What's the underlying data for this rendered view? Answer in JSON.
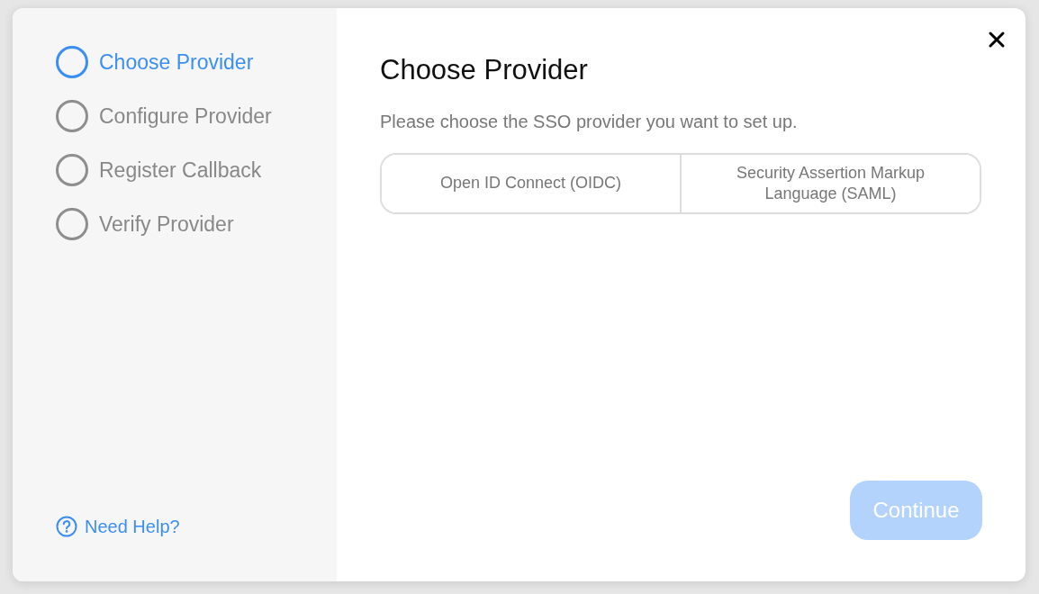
{
  "steps": [
    {
      "label": "Choose Provider",
      "selected": true
    },
    {
      "label": "Configure Provider",
      "selected": false
    },
    {
      "label": "Register Callback",
      "selected": false
    },
    {
      "label": "Verify Provider",
      "selected": false
    }
  ],
  "help_link": "Need Help?",
  "title": "Choose Provider",
  "description": "Please choose the SSO provider you want to set up.",
  "options": [
    {
      "label": "Open ID Connect (OIDC)",
      "selected": false
    },
    {
      "label": "Security Assertion Markup Language (SAML)",
      "selected": false
    }
  ],
  "continue_button": {
    "label": "Continue",
    "disabled": true
  }
}
